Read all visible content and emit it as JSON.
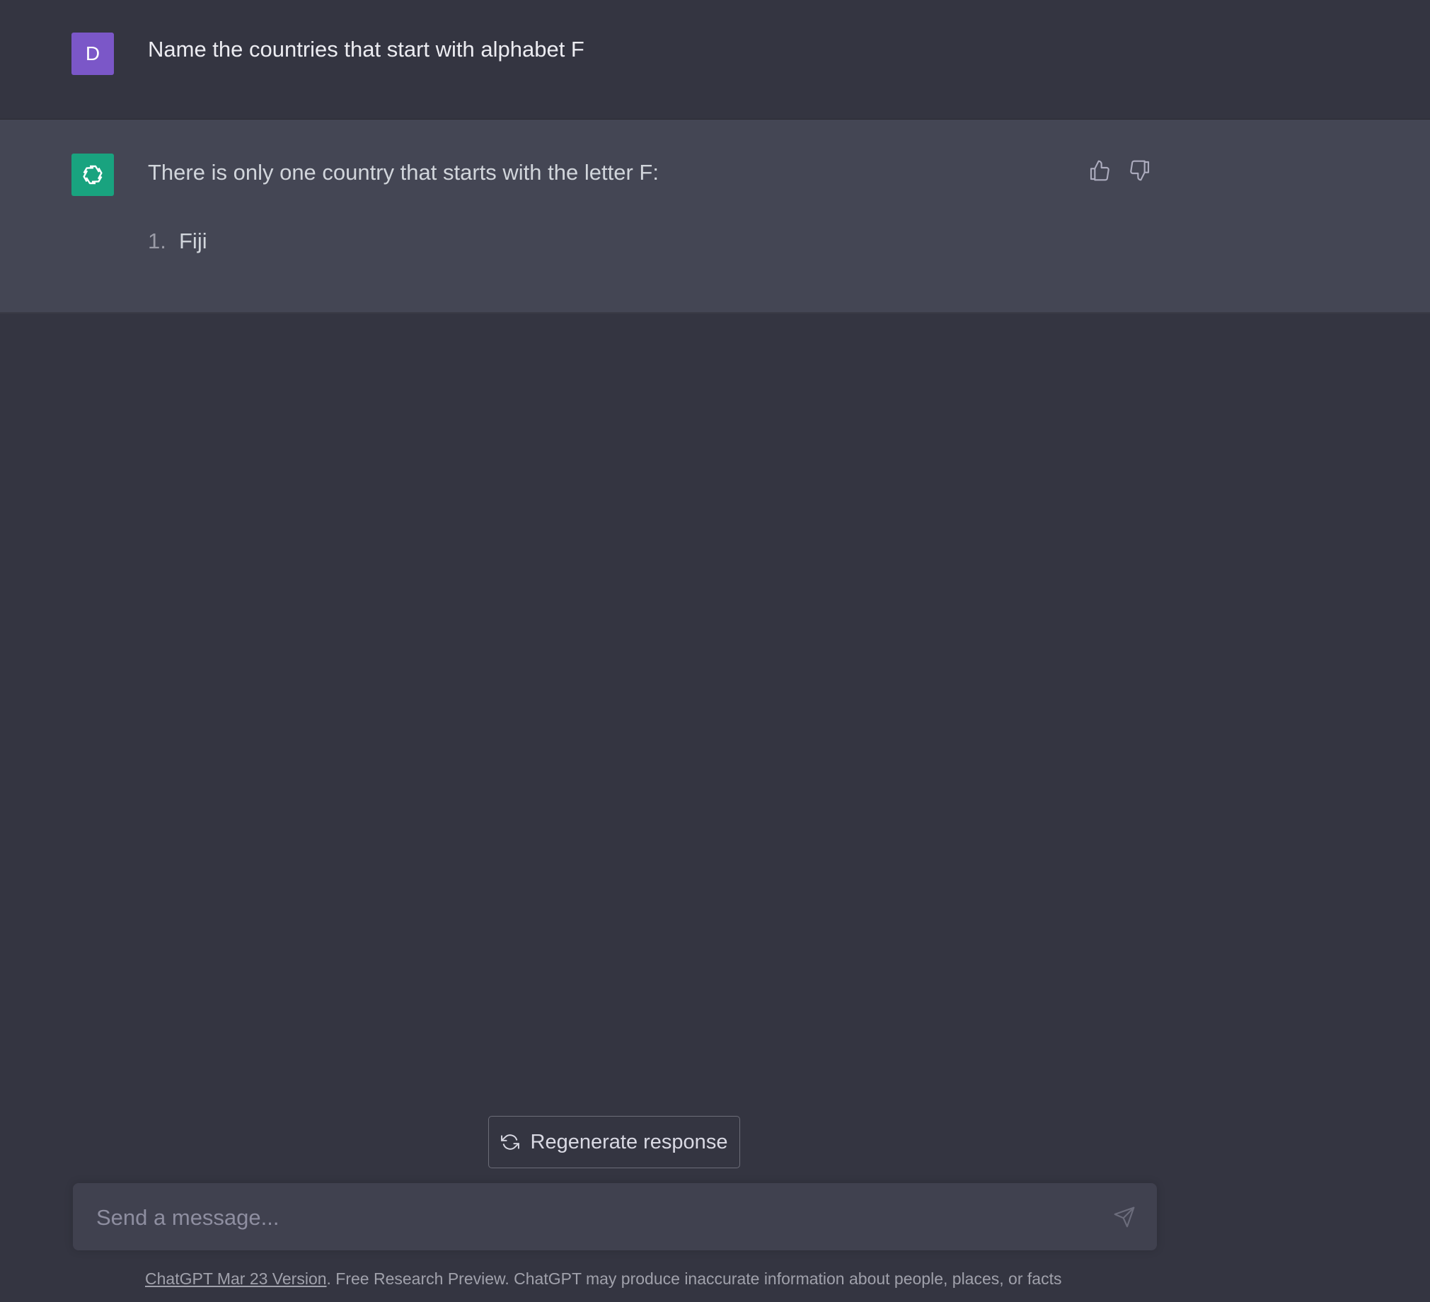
{
  "conversation": {
    "user_message": {
      "avatar_initial": "D",
      "avatar_color": "#7b57c8",
      "text": "Name the countries that start with alphabet F"
    },
    "assistant_message": {
      "avatar_icon": "openai-logo-icon",
      "avatar_color": "#19a37f",
      "intro": "There is only one country that starts with the letter F:",
      "list": [
        {
          "number": "1.",
          "text": "Fiji"
        }
      ],
      "feedback_icons": [
        "thumbs-up-icon",
        "thumbs-down-icon"
      ]
    }
  },
  "regenerate": {
    "icon": "refresh-icon",
    "label": "Regenerate response"
  },
  "composer": {
    "placeholder": "Send a message...",
    "value": "",
    "send_icon": "send-icon"
  },
  "footer": {
    "version_link": "ChatGPT Mar 23 Version",
    "disclaimer": ". Free Research Preview. ChatGPT may produce inaccurate information about people, places, or facts"
  }
}
